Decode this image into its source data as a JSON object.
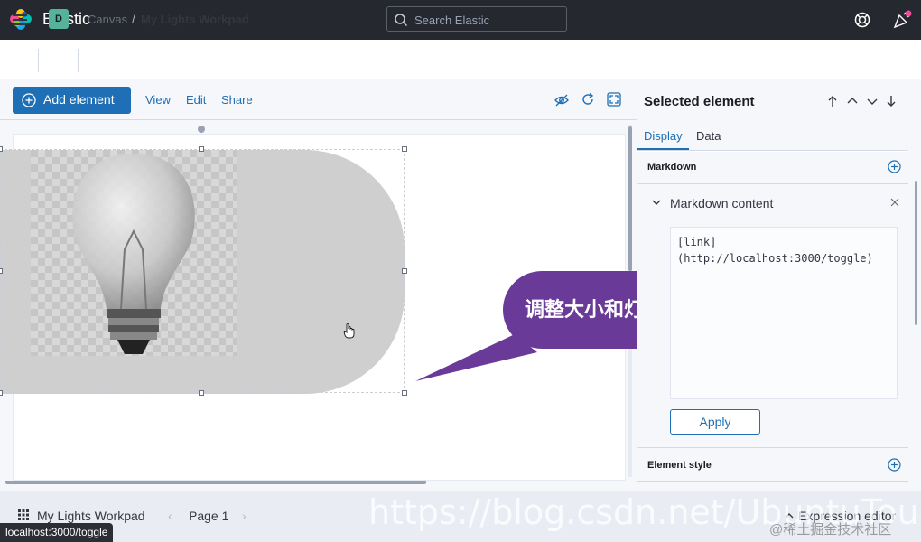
{
  "header": {
    "app_title": "Elastic",
    "search_placeholder": "Search Elastic"
  },
  "breadcrumb": {
    "space_initial": "D",
    "items": [
      "Canvas",
      "My Lights Workpad"
    ],
    "separator": "/"
  },
  "toolbar": {
    "add_element": "Add element",
    "view": "View",
    "edit": "Edit",
    "share": "Share"
  },
  "canvas": {
    "callout_text": "调整大小和灯一样",
    "callout_color": "#6a3a98",
    "element_color": "#cfcfcf"
  },
  "panel": {
    "title": "Selected element",
    "tabs": [
      {
        "label": "Display",
        "active": true
      },
      {
        "label": "Data",
        "active": false
      }
    ],
    "markdown_header": "Markdown",
    "markdown_content_title": "Markdown content",
    "markdown_value": "[link]\n(http://localhost:3000/toggle)",
    "apply": "Apply",
    "element_style": "Element style"
  },
  "footer": {
    "workpad_name": "My Lights Workpad",
    "page_label": "Page 1",
    "expression_editor": "Expression editor",
    "status_url": "localhost:3000/toggle",
    "watermark": "https://blog.csdn.net/UbuntuTouch",
    "watermark_secondary": "@稀土掘金技术社区"
  },
  "colors": {
    "header_bg": "#25282f",
    "accent": "#1e6fb5",
    "space_avatar": "#54b399"
  }
}
